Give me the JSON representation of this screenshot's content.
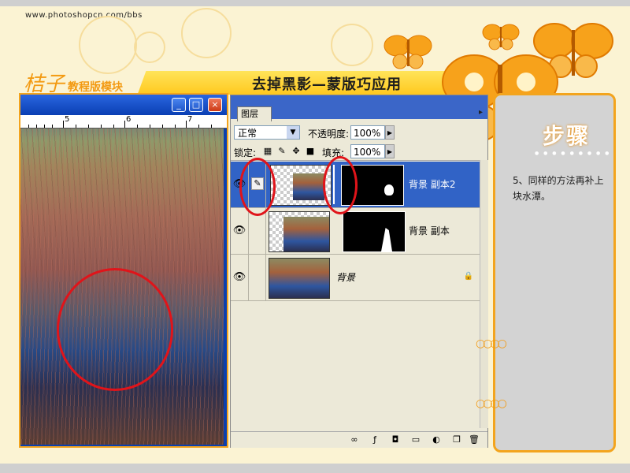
{
  "site": {
    "url": "www.photoshopcn.com/bbs"
  },
  "header": {
    "brand_main": "桔子",
    "brand_sub": "教程版模块",
    "title": "去掉黑影—蒙版巧应用"
  },
  "doc_window": {
    "buttons": {
      "minimize": "_",
      "maximize": "□",
      "close": "×"
    },
    "ruler_numbers": [
      "5",
      "6",
      "7"
    ]
  },
  "layers_panel": {
    "tab_label": "图层",
    "blend_mode": "正常",
    "opacity_label": "不透明度:",
    "opacity_value": "100%",
    "lock_label": "锁定:",
    "fill_label": "填充:",
    "fill_value": "100%",
    "layers": [
      {
        "name": "背景 副本2",
        "selected": true,
        "has_mask": true
      },
      {
        "name": "背景 副本",
        "selected": false,
        "has_mask": true
      },
      {
        "name": "背景",
        "selected": false,
        "has_mask": false,
        "locked": true
      }
    ],
    "footer_icons": [
      "link-layers-icon",
      "add-style-icon",
      "add-mask-icon",
      "new-group-icon",
      "adjustment-layer-icon",
      "new-layer-icon",
      "delete-layer-icon"
    ]
  },
  "steps": {
    "heading": "步骤",
    "text": "5、同样的方法再补上块水潭。"
  },
  "colors": {
    "accent_orange": "#f3a41d",
    "annotation_red": "#e0141a",
    "selection_blue": "#3163c6"
  }
}
